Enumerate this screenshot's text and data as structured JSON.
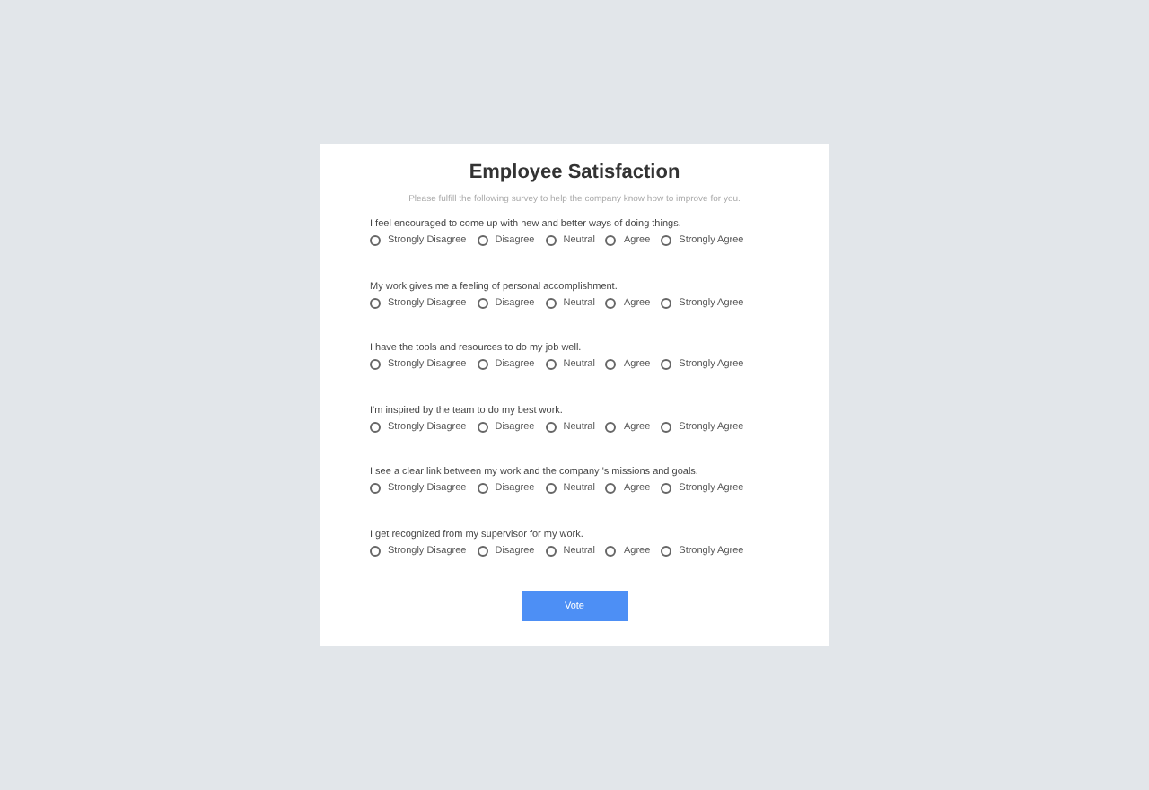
{
  "title": "Employee Satisfaction",
  "subtitle": "Please fulfill the following survey to help the company know how to improve for you.",
  "questions": [
    {
      "text": "I feel encouraged to come up with new and better ways of doing things.",
      "options": [
        {
          "label": "Strongly Disagree",
          "selected": false
        },
        {
          "label": "Disagree",
          "selected": false
        },
        {
          "label": "Neutral",
          "selected": false
        },
        {
          "label": "Agree",
          "selected": false
        },
        {
          "label": "Strongly Agree",
          "selected": false
        }
      ]
    },
    {
      "text": "My work gives me a feeling of personal accomplishment.",
      "options": [
        {
          "label": "Strongly Disagree",
          "selected": false
        },
        {
          "label": "Disagree",
          "selected": false
        },
        {
          "label": "Neutral",
          "selected": false
        },
        {
          "label": "Agree",
          "selected": false
        },
        {
          "label": "Strongly Agree",
          "selected": false
        }
      ]
    },
    {
      "text": "I have the tools and resources to do my job well.",
      "options": [
        {
          "label": "Strongly Disagree",
          "selected": false
        },
        {
          "label": "Disagree",
          "selected": false
        },
        {
          "label": "Neutral",
          "selected": false
        },
        {
          "label": "Agree",
          "selected": false
        },
        {
          "label": "Strongly Agree",
          "selected": false
        }
      ]
    },
    {
      "text": "I'm inspired by the team to do my best work.",
      "options": [
        {
          "label": "Strongly Disagree",
          "selected": false
        },
        {
          "label": "Disagree",
          "selected": false
        },
        {
          "label": "Neutral",
          "selected": false
        },
        {
          "label": "Agree",
          "selected": false
        },
        {
          "label": "Strongly Agree",
          "selected": false
        }
      ]
    },
    {
      "text": "I see a clear link between my work and the company 's missions and goals.",
      "options": [
        {
          "label": "Strongly Disagree",
          "selected": false
        },
        {
          "label": "Disagree",
          "selected": false
        },
        {
          "label": "Neutral",
          "selected": false
        },
        {
          "label": "Agree",
          "selected": false
        },
        {
          "label": "Strongly Agree",
          "selected": false
        }
      ]
    },
    {
      "text": "I get recognized from my supervisor for my work.",
      "options": [
        {
          "label": "Strongly Disagree",
          "selected": false
        },
        {
          "label": "Disagree",
          "selected": false
        },
        {
          "label": "Neutral",
          "selected": false
        },
        {
          "label": "Agree",
          "selected": false
        },
        {
          "label": "Strongly Agree",
          "selected": false
        }
      ]
    }
  ],
  "submit": "Vote"
}
